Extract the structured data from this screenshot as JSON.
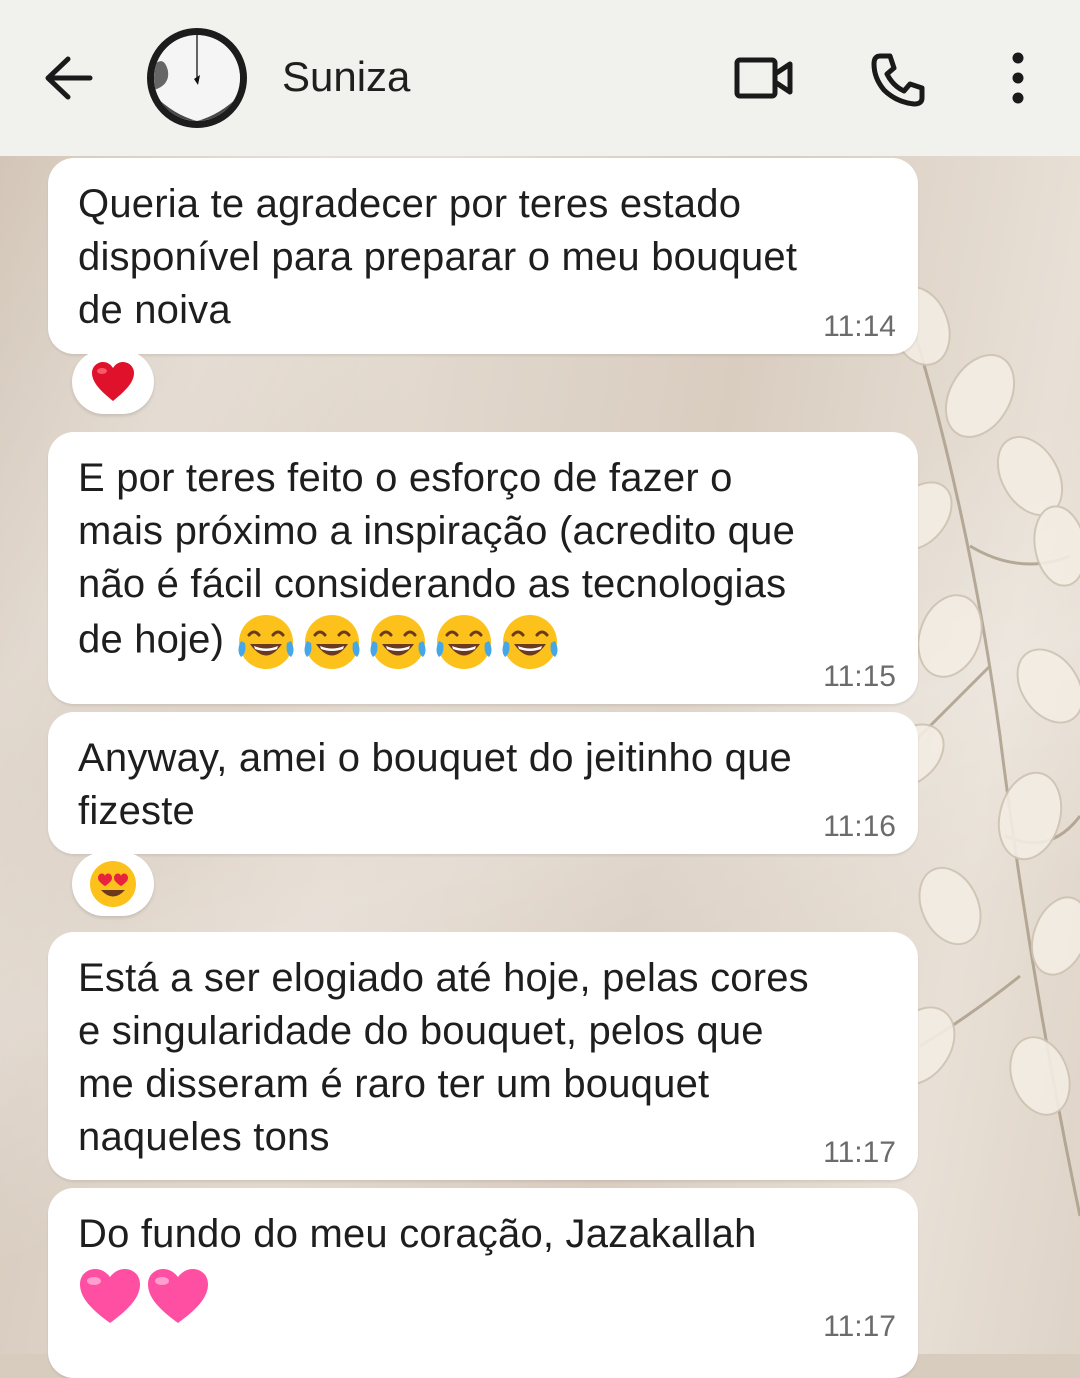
{
  "header": {
    "contact_name": "Suniza"
  },
  "messages": [
    {
      "text": "Queria te agradecer por teres estado\ndisponível para preparar o meu bouquet\nde noiva",
      "time": "11:14",
      "reaction": "red-heart"
    },
    {
      "text": "E por teres feito o esforço de fazer o\nmais próximo a inspiração (acredito que\nnão é fácil considerando as tecnologias\nde hoje) ",
      "emoji": [
        "😂",
        "😂",
        "😂",
        "😂",
        "😂"
      ],
      "time": "11:15"
    },
    {
      "text": "Anyway, amei o bouquet do jeitinho que\nfizeste",
      "time": "11:16",
      "reaction": "heart-eyes"
    },
    {
      "text": "Está a ser elogiado até hoje, pelas cores\ne singularidade do bouquet, pelos que\nme disseram é raro ter um bouquet\nnaqueles tons",
      "time": "11:17"
    },
    {
      "text": "Do fundo do meu coração, Jazakallah",
      "emoji": [
        "💗",
        "💗"
      ],
      "time": "11:17"
    }
  ],
  "colors": {
    "header_bg": "#f1f1ee",
    "bubble_bg": "#ffffff",
    "time_text": "#6b6b6b"
  }
}
